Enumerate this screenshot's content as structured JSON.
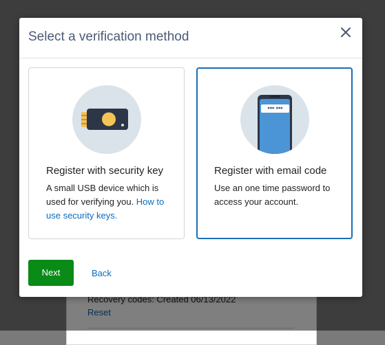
{
  "background": {
    "recovery_text": "Recovery codes: Created 06/13/2022",
    "reset_link": "Reset"
  },
  "modal": {
    "title": "Select a verification method",
    "close_icon": "close-icon",
    "options": [
      {
        "icon": "usb-security-key-icon",
        "title": "Register with security key",
        "description": "A small USB device which is used for verifying you. ",
        "link_text": "How to use security keys."
      },
      {
        "icon": "mobile-phone-icon",
        "phone_code": "*** ***",
        "title": "Register with email code",
        "description": "Use an one time password to access your account.",
        "selected": true
      }
    ],
    "next_label": "Next",
    "back_label": "Back"
  },
  "colors": {
    "primary_button": "#0a8a17",
    "link": "#0b6bbf",
    "selected_border": "#1a6fb4",
    "title": "#4a5a75"
  }
}
